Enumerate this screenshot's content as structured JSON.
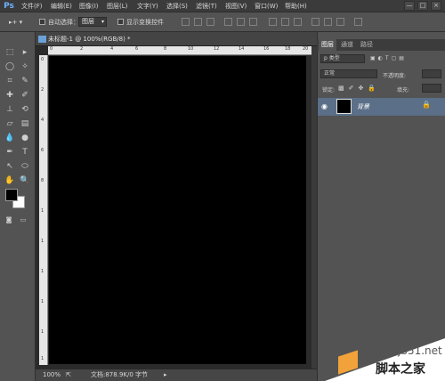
{
  "app": {
    "logo": "Ps"
  },
  "menu": [
    "文件(F)",
    "编辑(E)",
    "图像(I)",
    "图层(L)",
    "文字(Y)",
    "选择(S)",
    "滤镜(T)",
    "视图(V)",
    "窗口(W)",
    "帮助(H)"
  ],
  "window_controls": {
    "minimize": "—",
    "maximize": "□",
    "close": "×"
  },
  "options_bar": {
    "auto_select_label": "自动选择：",
    "auto_select_value": "图层",
    "show_transform_label": "显示变换控件"
  },
  "document": {
    "tab_title": "未标题-1 @ 100%(RGB/8) *",
    "ruler_top_numbers": [
      "0",
      "2",
      "4",
      "6",
      "8",
      "10",
      "12",
      "14",
      "16",
      "18",
      "20"
    ],
    "ruler_left_numbers": [
      "0",
      "2",
      "4",
      "6",
      "8",
      "1",
      "1",
      "1",
      "1",
      "1",
      "1"
    ],
    "zoom": "100%",
    "status_info": "文档:878.9K/0 字节"
  },
  "layers_panel": {
    "tabs": [
      "图层",
      "通道",
      "路径"
    ],
    "filter_kind": "p 类型",
    "blend_mode": "正常",
    "opacity_label": "不透明度:",
    "lock_label": "锁定:",
    "fill_label": "填充:",
    "layer_name": "背景"
  },
  "watermark": {
    "site": "jb51.net",
    "brand": "脚本之家"
  },
  "colors": {
    "canvas": "#000000",
    "layer_selected": "#5b6f88",
    "accent": "#6db3ff"
  }
}
